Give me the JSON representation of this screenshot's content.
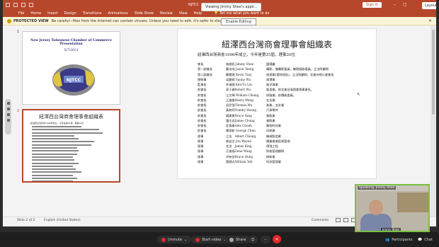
{
  "window": {
    "doc_title": "NJTCC",
    "viewing_banner": "Viewing Jimmy Shee's appli...",
    "sign_in": "Sign in",
    "layout_button": "Layout"
  },
  "menu": [
    "File",
    "Home",
    "Insert",
    "Design",
    "Transitions",
    "Animations",
    "Slide Show",
    "Review",
    "View",
    "Help"
  ],
  "tell_me": "Tell me what you want to do",
  "protected_view": {
    "label": "PROTECTED VIEW",
    "message": "Be careful—files from the Internet can contain viruses. Unless you need to edit, it's safer to stay in Protected View.",
    "button": "Enable Editing"
  },
  "thumbnails": [
    {
      "number": "1",
      "title": "New Jersey Taiwanese Chamber of Commerce Presentation",
      "date": "5/7/2021",
      "logo_text": "NJTCC"
    },
    {
      "number": "2",
      "title": "紐澤西台灣商會理事會組織表",
      "subtitle": "紐澤西台灣商會1996年成立，今年是第25屆，理事20位"
    }
  ],
  "slide": {
    "title": "紐澤西台灣商會理事會組織表",
    "subtitle": "紐澤西台灣商會1996年成立，今年是第25屆，理事20位",
    "rows": [
      [
        "會長",
        "施俊銘 Jimmy Shee",
        "盟環麗"
      ],
      [
        "第一副會長",
        "鄭忠成 Jason Tseng",
        "攝影，兼攝影委員，聯理服務委員，立法院顧問"
      ],
      [
        "第二副會長",
        "鄭慶煌 Kevin Tsay",
        "旅遊業(東財務長)，立法院顧問，北美州總公會會長"
      ],
      [
        "總幹事",
        "吳慶堯 Sanny Wu",
        "珠寶業"
      ],
      [
        "監事長",
        "許振國 Ken-Tu Lin",
        "進洋珠業"
      ],
      [
        "前會長",
        "高于瑭Robert Wu",
        "製造業，前北美台灣理會理事會長。"
      ],
      [
        "前會長",
        "江文輝 William Chiang",
        "保險業，前僑務委員。"
      ],
      [
        "前會長",
        "王進雄Henry Wang",
        "五金業"
      ],
      [
        "前會長",
        "吳民強Thomas Wu",
        "香業，五金業"
      ],
      [
        "前會長",
        "黃乾明Tommy Hsung",
        "汽車零件"
      ],
      [
        "前會長",
        "楊建勇Bruce Yang",
        "餐飲業"
      ],
      [
        "前會長",
        "鐘文忠James Chung",
        "餐飲業"
      ],
      [
        "前會長",
        "莊素秦Alex Chueh",
        "藥物科技業"
      ],
      [
        "前會長",
        "陳家齡 George Chen",
        "印刷業"
      ],
      [
        "理事",
        "江浩　Albert Chiang",
        "機械製造業"
      ],
      [
        "理事",
        "詹益文 Jon Wayne",
        "僑業會業投資管理"
      ],
      [
        "理事",
        "金涼　James King",
        "環境工程"
      ],
      [
        "理事",
        "汪進福Gene Wang",
        "財務管理顧問"
      ],
      [
        "理事",
        "洪有宜Bruce Hung",
        "移新業"
      ],
      [
        "理事",
        "葉銷志William Yeh",
        "科技管理業"
      ]
    ]
  },
  "status": {
    "slide_of": "Slide 2 of 2",
    "language": "English (United States)",
    "comments": "Comments"
  },
  "video": {
    "speaking": "Speaking: Jimmy Shee",
    "name": "Jimmy Shee"
  },
  "zoom_toolbar": {
    "unmute": "Unmute",
    "start_video": "Start video",
    "share": "Share",
    "participants": "Participants",
    "chat": "Chat"
  }
}
